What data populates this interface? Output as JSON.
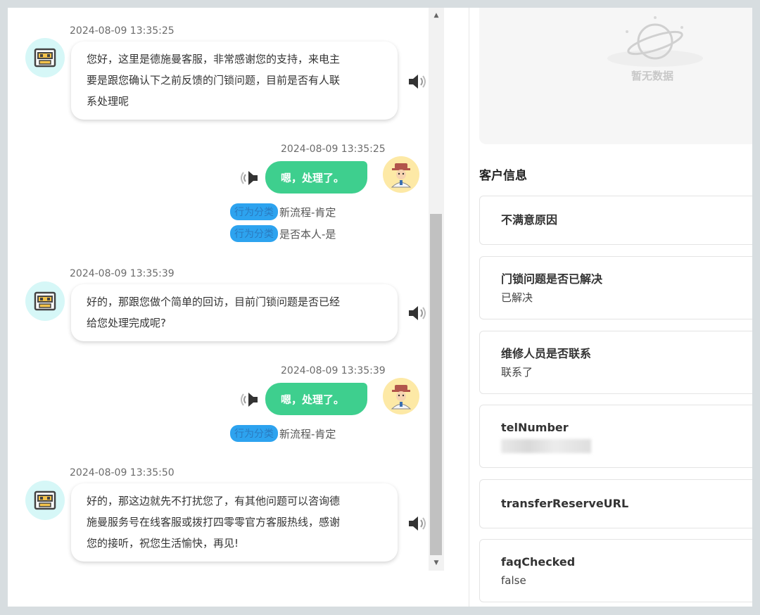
{
  "chat": {
    "messages": [
      {
        "role": "bot",
        "time": "2024-08-09 13:35:25",
        "lines": [
          "您好，这里是德施曼客服，非常感谢您的支持，来电主",
          "要是跟您确认下之前反馈的门锁问题，目前是否有人联",
          "系处理呢"
        ]
      },
      {
        "role": "user",
        "time": "2024-08-09 13:35:25",
        "text": "嗯，处理了。",
        "tags": [
          {
            "label": "行为分类",
            "value": "新流程-肯定"
          },
          {
            "label": "行为分类",
            "value": "是否本人-是"
          }
        ]
      },
      {
        "role": "bot",
        "time": "2024-08-09 13:35:39",
        "lines": [
          "好的，那跟您做个简单的回访，目前门锁问题是否已经",
          "给您处理完成呢?"
        ]
      },
      {
        "role": "user",
        "time": "2024-08-09 13:35:39",
        "text": "嗯，处理了。",
        "tags": [
          {
            "label": "行为分类",
            "value": "新流程-肯定"
          }
        ]
      },
      {
        "role": "bot",
        "time": "2024-08-09 13:35:50",
        "lines": [
          "好的，那这边就先不打扰您了，有其他问题可以咨询德",
          "施曼服务号在线客服或拨打四零零官方客服热线，感谢",
          "您的接听，祝您生活愉快，再见!"
        ]
      }
    ]
  },
  "empty_state": {
    "text": "暂无数据"
  },
  "customer_info": {
    "title": "客户信息",
    "fields": [
      {
        "label": "不满意原因",
        "value": ""
      },
      {
        "label": "门锁问题是否已解决",
        "value": "已解决"
      },
      {
        "label": "维修人员是否联系",
        "value": "联系了"
      },
      {
        "label": "telNumber",
        "value": ""
      },
      {
        "label": "transferReserveURL",
        "value": ""
      },
      {
        "label": "faqChecked",
        "value": "false"
      }
    ]
  },
  "icons": {
    "bot_avatar": "robot-icon",
    "user_avatar": "user-avatar-icon",
    "speaker": "speaker-icon",
    "empty": "planet-icon"
  },
  "colors": {
    "user_bubble": "#3ecf8e",
    "tag_bg": "#2da3ef",
    "bot_avatar_bg": "#d6f7f7",
    "user_avatar_bg": "#fde9a6"
  }
}
